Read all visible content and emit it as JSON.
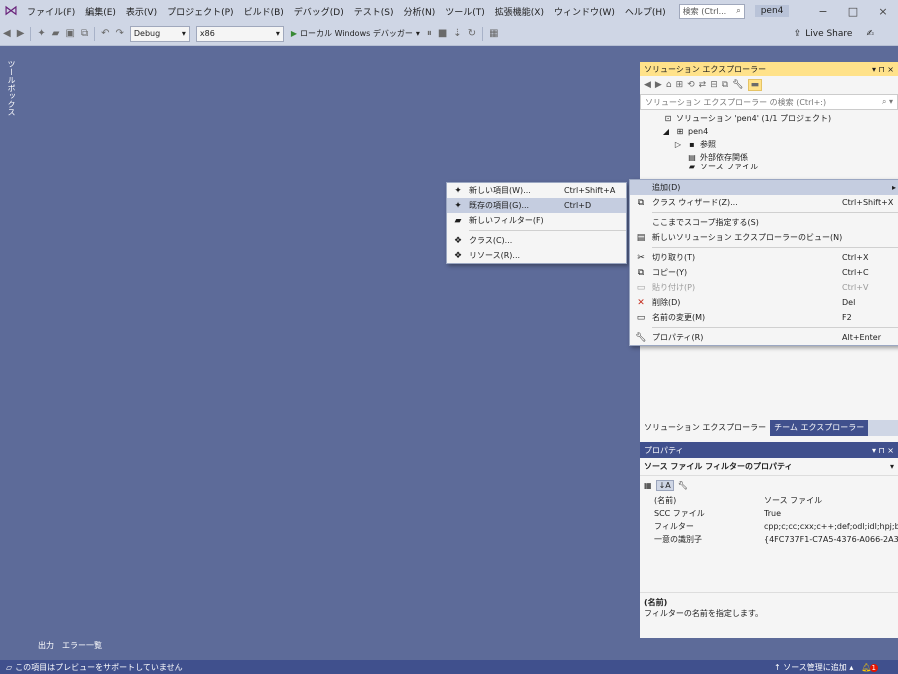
{
  "menubar": {
    "items": [
      "ファイル(F)",
      "編集(E)",
      "表示(V)",
      "プロジェクト(P)",
      "ビルド(B)",
      "デバッグ(D)",
      "テスト(S)",
      "分析(N)",
      "ツール(T)",
      "拡張機能(X)",
      "ウィンドウ(W)",
      "ヘルプ(H)"
    ],
    "search_placeholder": "検索 (Ctrl...",
    "solution_name": "pen4",
    "minimize": "−",
    "maximize": "□",
    "close": "×"
  },
  "toolbar": {
    "config": "Debug",
    "platform": "x86",
    "debugger": "ローカル Windows デバッガー",
    "live_share": "Live Share"
  },
  "toolbox_label": "ツールボックス",
  "bottom_tabs": [
    "出力",
    "エラー一覧"
  ],
  "statusbar": {
    "message": "この項目はプレビューをサポートしていません",
    "source_control": "ソース管理に追加",
    "notification_count": "1"
  },
  "solution_explorer": {
    "title": "ソリューション エクスプローラー",
    "title_controls": "▾ ⊓ ×",
    "search_placeholder": "ソリューション エクスプローラー の検索 (Ctrl+:)",
    "tree": [
      {
        "label": "ソリューション 'pen4' (1/1 プロジェクト)",
        "indent": 0,
        "icon": "solution-icon"
      },
      {
        "label": "pen4",
        "indent": 1,
        "icon": "project-icon"
      },
      {
        "label": "参照",
        "indent": 2,
        "icon": "references-icon"
      },
      {
        "label": "外部依存関係",
        "indent": 2,
        "icon": "external-deps-icon"
      },
      {
        "label": "ソース ファイル",
        "indent": 2,
        "icon": "folder-icon"
      }
    ],
    "tabs": [
      "ソリューション エクスプローラー",
      "チーム エクスプローラー"
    ]
  },
  "properties": {
    "title": "プロパティ",
    "title_controls": "▾ ⊓ ×",
    "selector": "ソース ファイル フィルターのプロパティ",
    "rows": [
      {
        "key": "(名前)",
        "value": "ソース ファイル"
      },
      {
        "key": "SCC ファイル",
        "value": "True"
      },
      {
        "key": "フィルター",
        "value": "cpp;c;cc;cxx;c++;def;odl;idl;hpj;b"
      },
      {
        "key": "一意の識別子",
        "value": "{4FC737F1-C7A5-4376-A066-2A3"
      }
    ],
    "desc_title": "(名前)",
    "desc_text": "フィルターの名前を指定します。"
  },
  "context_menu": {
    "items": [
      {
        "label": "追加(D)",
        "shortcut": "",
        "icon": "",
        "highlighted": true,
        "arrow": "▸"
      },
      {
        "label": "クラス ウィザード(Z)...",
        "shortcut": "Ctrl+Shift+X",
        "icon": "class-wizard-icon"
      },
      {
        "sep": true
      },
      {
        "label": "ここまでスコープ指定する(S)",
        "shortcut": "",
        "icon": ""
      },
      {
        "label": "新しいソリューション エクスプローラーのビュー(N)",
        "shortcut": "",
        "icon": "new-view-icon"
      },
      {
        "sep": true
      },
      {
        "label": "切り取り(T)",
        "shortcut": "Ctrl+X",
        "icon": "cut-icon"
      },
      {
        "label": "コピー(Y)",
        "shortcut": "Ctrl+C",
        "icon": "copy-icon"
      },
      {
        "label": "貼り付け(P)",
        "shortcut": "Ctrl+V",
        "icon": "paste-icon",
        "disabled": true
      },
      {
        "label": "削除(D)",
        "shortcut": "Del",
        "icon": "delete-icon"
      },
      {
        "label": "名前の変更(M)",
        "shortcut": "F2",
        "icon": "rename-icon"
      },
      {
        "sep": true
      },
      {
        "label": "プロパティ(R)",
        "shortcut": "Alt+Enter",
        "icon": "wrench-icon"
      }
    ]
  },
  "sub_menu": {
    "items": [
      {
        "label": "新しい項目(W)...",
        "shortcut": "Ctrl+Shift+A",
        "icon": "new-item-icon"
      },
      {
        "label": "既存の項目(G)...",
        "shortcut": "Ctrl+D",
        "icon": "existing-item-icon",
        "highlighted": true
      },
      {
        "label": "新しいフィルター(F)",
        "shortcut": "",
        "icon": "new-filter-icon"
      },
      {
        "sep": true
      },
      {
        "label": "クラス(C)...",
        "shortcut": "",
        "icon": "class-icon"
      },
      {
        "label": "リソース(R)...",
        "shortcut": "",
        "icon": "resource-icon"
      }
    ]
  },
  "colors": {
    "background": "#5d6b99",
    "highlight_tab": "#ffe28a",
    "status_bar": "#40508d"
  }
}
